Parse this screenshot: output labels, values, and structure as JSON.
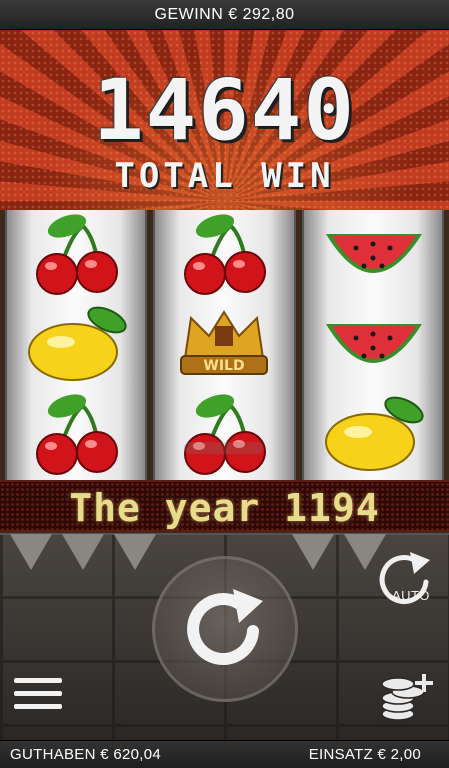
{
  "header": {
    "win_text": "GEWINN € 292,80"
  },
  "banner": {
    "amount": "14640",
    "label": "TOTAL WIN"
  },
  "reels": [
    [
      "cherries",
      "lemon",
      "cherries"
    ],
    [
      "cherries",
      "crown-wild",
      "cherries"
    ],
    [
      "watermelon",
      "watermelon",
      "lemon"
    ]
  ],
  "wild_label": "WILD",
  "info_text": "The year 1194",
  "controls": {
    "auto_label": "AUTO"
  },
  "footer": {
    "balance": "GUTHABEN € 620,04",
    "bet": "EINSATZ € 2,00"
  },
  "colors": {
    "banner_red": "#c23a1f",
    "info_text": "#e8dc8a",
    "cherry": "#d0141a",
    "lemon": "#f6d21a",
    "melon": "#e0303a"
  }
}
